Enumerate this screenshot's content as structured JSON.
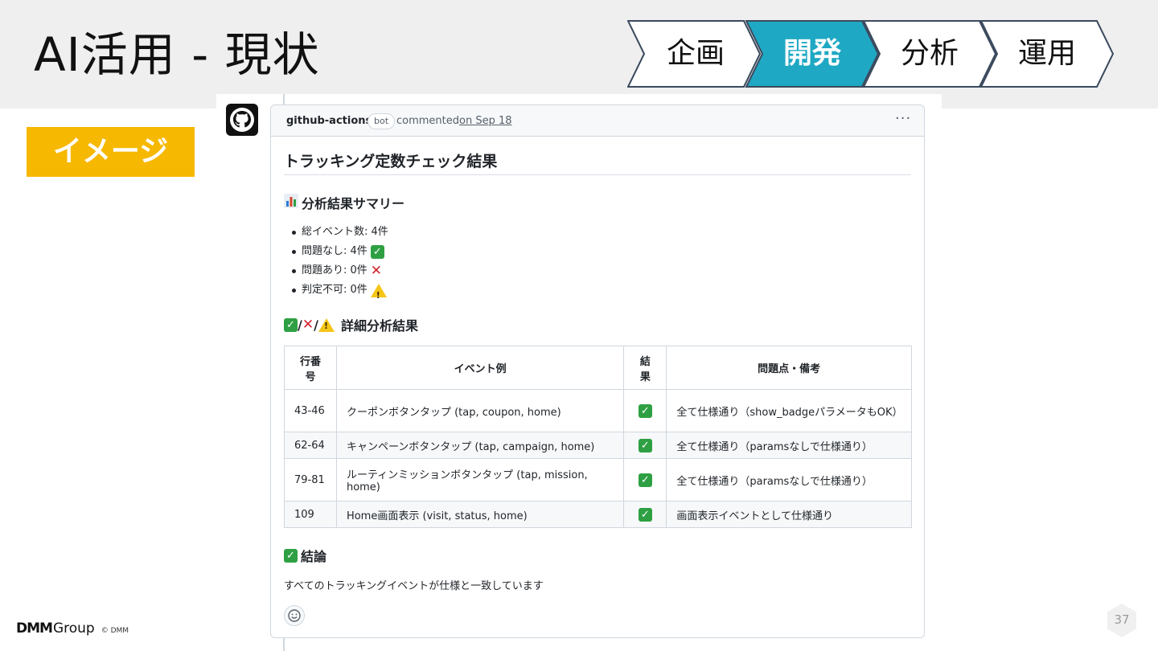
{
  "slide": {
    "title": "AI活用 - 現状",
    "badge": "イメージ",
    "page_number": "37"
  },
  "steps": [
    {
      "label": "企画",
      "active": false
    },
    {
      "label": "開発",
      "active": true
    },
    {
      "label": "分析",
      "active": false
    },
    {
      "label": "運用",
      "active": false
    }
  ],
  "colors": {
    "active_step": "#1fa8c4",
    "badge": "#f6b800",
    "check": "#2ea043",
    "cross": "#d1242f"
  },
  "comment": {
    "author": "github-actions",
    "bot_label": "bot",
    "action": "commented",
    "date": "on Sep 18",
    "more": "···",
    "heading": "トラッキング定数チェック結果",
    "summary_heading": "分析結果サマリー",
    "summary_items": [
      {
        "text": "総イベント数: 4件",
        "icon": "none"
      },
      {
        "text": "問題なし: 4件",
        "icon": "check"
      },
      {
        "text": "問題あり: 0件",
        "icon": "cross"
      },
      {
        "text": "判定不可: 0件",
        "icon": "warning"
      }
    ],
    "detail_heading_sep": "/",
    "detail_heading": "詳細分析結果",
    "table": {
      "headers": [
        "行番号",
        "イベント例",
        "結果",
        "問題点・備考"
      ],
      "header_lines": {
        "col1_line1": "行番",
        "col1_line2": "号",
        "col3_line1": "結",
        "col3_line2": "果"
      },
      "rows": [
        {
          "lines": "43-46",
          "event": "クーポンボタンタップ (tap, coupon, home)",
          "result": "✓",
          "note": "全て仕様通り（show_badgeパラメータもOK）"
        },
        {
          "lines": "62-64",
          "event": "キャンペーンボタンタップ (tap, campaign, home)",
          "result": "✓",
          "note": "全て仕様通り（paramsなしで仕様通り）"
        },
        {
          "lines": "79-81",
          "event": "ルーティンミッションボタンタップ (tap, mission, home)",
          "result": "✓",
          "note": "全て仕様通り（paramsなしで仕様通り）"
        },
        {
          "lines": "109",
          "event": "Home画面表示 (visit, status, home)",
          "result": "✓",
          "note": "画面表示イベントとして仕様通り"
        }
      ]
    },
    "conclusion_heading": "結論",
    "conclusion_text": "すべてのトラッキングイベントが仕様と一致しています"
  },
  "footer": {
    "brand_bold": "DMM",
    "brand_rest": "Group",
    "copyright": "© DMM"
  },
  "icons": [
    "github-logo-icon",
    "chart-icon",
    "check-icon",
    "cross-icon",
    "warning-icon",
    "smiley-icon",
    "more-icon"
  ]
}
